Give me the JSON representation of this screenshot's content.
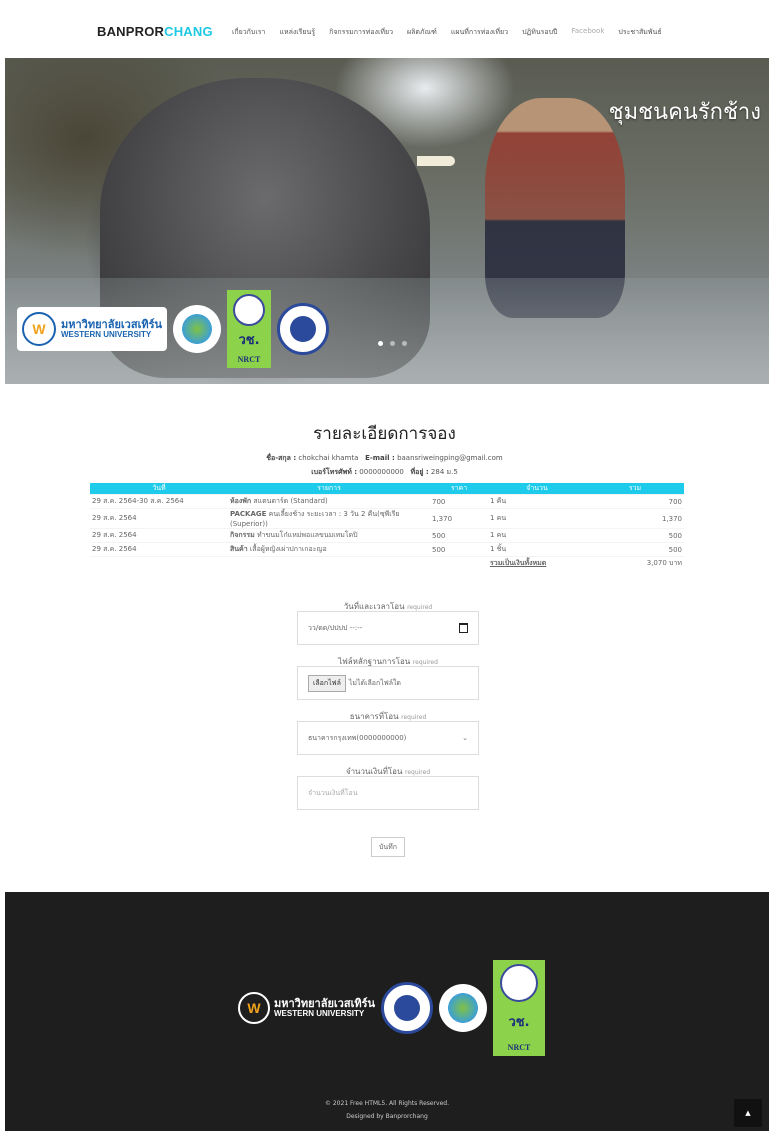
{
  "nav": {
    "brand_dark": "BANPROR",
    "brand_accent": "CHANG",
    "items": [
      "เกี่ยวกับเรา",
      "แหล่งเรียนรู้",
      "กิจกรรมการท่องเที่ยว",
      "ผลิตภัณฑ์",
      "แผนที่การท่องเที่ยว",
      "ปฏิทินรอบปี",
      "Facebook",
      "ประชาสัมพันธ์"
    ]
  },
  "hero": {
    "title": "ชุมชนคนรักช้าง",
    "logo_wu_th": "มหาวิทยาลัยเวสเทิร์น",
    "logo_wu_en": "WESTERN UNIVERSITY",
    "logo_nrct_th": "วช.",
    "logo_nrct_en": "NRCT",
    "slide_count": 3,
    "active_slide": 1
  },
  "booking": {
    "heading": "รายละเอียดการจอง",
    "customer": {
      "name_label": "ชื่อ-สกุล :",
      "name": "chokchai khamta",
      "email_label": "E-mail :",
      "email": "baansriweingping@gmail.com",
      "phone_label": "เบอร์โทรศัพท์ :",
      "phone": "0000000000",
      "address_label": "ที่อยู่ :",
      "address": "284 ม.5"
    },
    "columns": [
      "วันที่",
      "รายการ",
      "ราคา",
      "จำนวน",
      "รวม"
    ],
    "rows": [
      {
        "date": "29 ส.ค. 2564-30 ส.ค. 2564",
        "type": "ห้องพัก",
        "desc": "สแตนดาร์ด (Standard)",
        "price": "700",
        "qty": "1 คืน",
        "total": "700"
      },
      {
        "date": "29 ส.ค. 2564",
        "type": "PACKAGE",
        "desc": "คนเลี้ยงช้าง ระยะเวลา : 3 วัน 2 คืน(ซุพีเรีย (Superior))",
        "price": "1,370",
        "qty": "1 คน",
        "total": "1,370"
      },
      {
        "date": "29 ส.ค. 2564",
        "type": "กิจกรรม",
        "desc": "ทำขนมโก๋แหม่พอแลขนมเทมโดปิ",
        "price": "500",
        "qty": "1 คน",
        "total": "500"
      },
      {
        "date": "29 ส.ค. 2564",
        "type": "สินค้า",
        "desc": "เสื้อผู้หญิงเผ่าปกาเกอะญอ",
        "price": "500",
        "qty": "1 ชิ้น",
        "total": "500"
      }
    ],
    "grand_total_label": "รวมเป็นเงินทั้งหมด",
    "grand_total": "3,070 บาท"
  },
  "form": {
    "datetime_label": "วันที่และเวลาโอน",
    "datetime_placeholder": "วว/ดด/ปปปป --:--",
    "slip_label": "ไฟล์หลักฐานการโอน",
    "file_button": "เลือกไฟล์",
    "file_status": "ไม่ได้เลือกไฟล์ใด",
    "bank_label": "ธนาคารที่โอน",
    "bank_selected": "ธนาคารกรุงเทพ(0000000000)",
    "amount_label": "จำนวนเงินที่โอน",
    "amount_placeholder": "จำนวนเงินที่โอน",
    "required": "required",
    "submit": "บันทึก"
  },
  "footer": {
    "copyright": "© 2021 Free HTML5. All Rights Reserved.",
    "designed_by": "Designed by Banprorchang"
  },
  "colors": {
    "accent": "#1fcbea",
    "footer_bg": "#1e1e1e",
    "nrct_green": "#8cd24a"
  }
}
